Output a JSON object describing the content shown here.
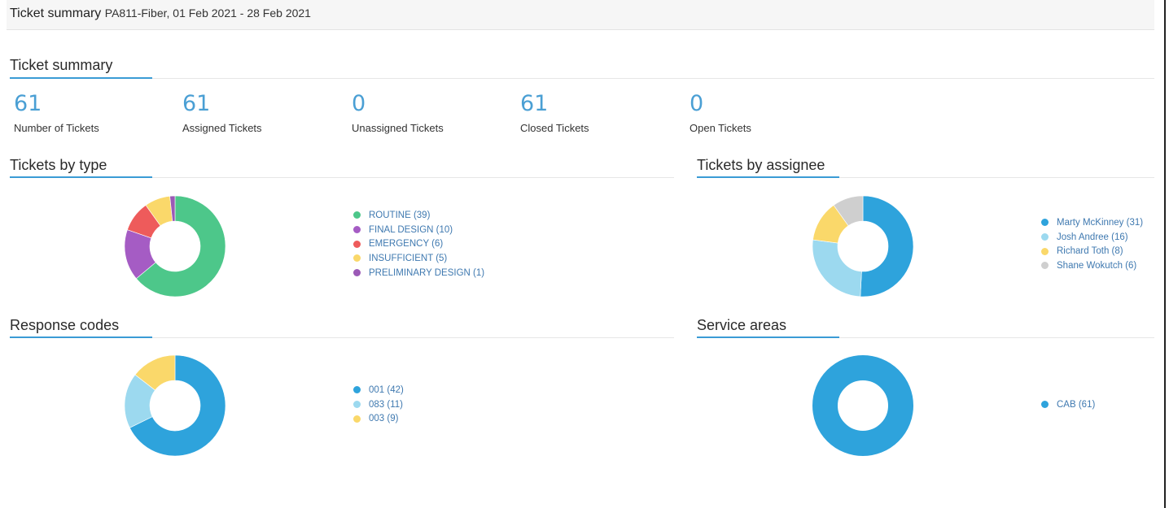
{
  "header": {
    "title": "Ticket summary",
    "subtitle": "PA811-Fiber, 01 Feb 2021 - 28 Feb 2021"
  },
  "summary": {
    "heading": "Ticket summary",
    "stats": [
      {
        "value": "61",
        "label": "Number of Tickets"
      },
      {
        "value": "61",
        "label": "Assigned Tickets"
      },
      {
        "value": "0",
        "label": "Unassigned Tickets"
      },
      {
        "value": "61",
        "label": "Closed Tickets"
      },
      {
        "value": "0",
        "label": "Open Tickets"
      }
    ]
  },
  "colors": {
    "accent": "#3a9bd5",
    "stat_value": "#4a9fd4",
    "legend_text": "#3f79b0"
  },
  "charts": {
    "by_type": {
      "heading": "Tickets by type",
      "slices": [
        {
          "label": "ROUTINE (39)",
          "value": 39,
          "color": "#4dc78a"
        },
        {
          "label": "FINAL DESIGN (10)",
          "value": 10,
          "color": "#a55cc4"
        },
        {
          "label": "EMERGENCY (6)",
          "value": 6,
          "color": "#ee5b5b"
        },
        {
          "label": "INSUFFICIENT (5)",
          "value": 5,
          "color": "#fad86a"
        },
        {
          "label": "PRELIMINARY DESIGN (1)",
          "value": 1,
          "color": "#9b59b6"
        }
      ]
    },
    "by_assignee": {
      "heading": "Tickets by assignee",
      "slices": [
        {
          "label": "Marty McKinney (31)",
          "value": 31,
          "color": "#2ea3dc"
        },
        {
          "label": "Josh Andree (16)",
          "value": 16,
          "color": "#9cd9ef"
        },
        {
          "label": "Richard Toth (8)",
          "value": 8,
          "color": "#fad86a"
        },
        {
          "label": "Shane Wokutch (6)",
          "value": 6,
          "color": "#cfcfcf"
        }
      ]
    },
    "response_codes": {
      "heading": "Response codes",
      "slices": [
        {
          "label": "001 (42)",
          "value": 42,
          "color": "#2ea3dc"
        },
        {
          "label": "083 (11)",
          "value": 11,
          "color": "#9cd9ef"
        },
        {
          "label": "003 (9)",
          "value": 9,
          "color": "#fad86a"
        }
      ]
    },
    "service_areas": {
      "heading": "Service areas",
      "slices": [
        {
          "label": "CAB (61)",
          "value": 61,
          "color": "#2ea3dc"
        }
      ]
    }
  }
}
